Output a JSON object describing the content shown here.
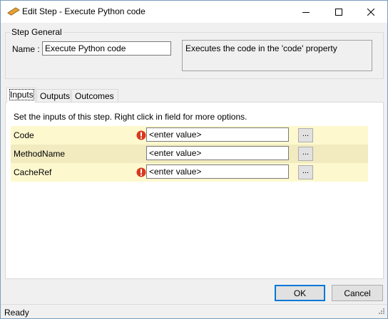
{
  "window": {
    "title": "Edit Step - Execute Python code",
    "controls": {
      "minimize": "minimize-icon",
      "maximize": "maximize-icon",
      "close": "close-icon"
    }
  },
  "step_general": {
    "legend": "Step General",
    "name_label": "Name :",
    "name_value": "Execute Python code",
    "description": "Executes the code in the 'code' property"
  },
  "tabs": [
    {
      "label": "Inputs",
      "active": true
    },
    {
      "label": "Outputs",
      "active": false
    },
    {
      "label": "Outcomes",
      "active": false
    }
  ],
  "inputs_panel": {
    "instructions": "Set the inputs of this step.  Right click in field for more options.",
    "rows": [
      {
        "name": "Code",
        "value": "<enter value>",
        "warning": true,
        "browse_label": "..."
      },
      {
        "name": "MethodName",
        "value": "<enter value>",
        "warning": false,
        "browse_label": "..."
      },
      {
        "name": "CacheRef",
        "value": "<enter value>",
        "warning": true,
        "browse_label": "..."
      }
    ]
  },
  "buttons": {
    "ok": "OK",
    "cancel": "Cancel"
  },
  "status": {
    "text": "Ready"
  },
  "colors": {
    "row_odd": "#fef8cf",
    "row_even": "#f1ebbf",
    "warning": "#d9381e",
    "focus_border": "#0078d7"
  }
}
